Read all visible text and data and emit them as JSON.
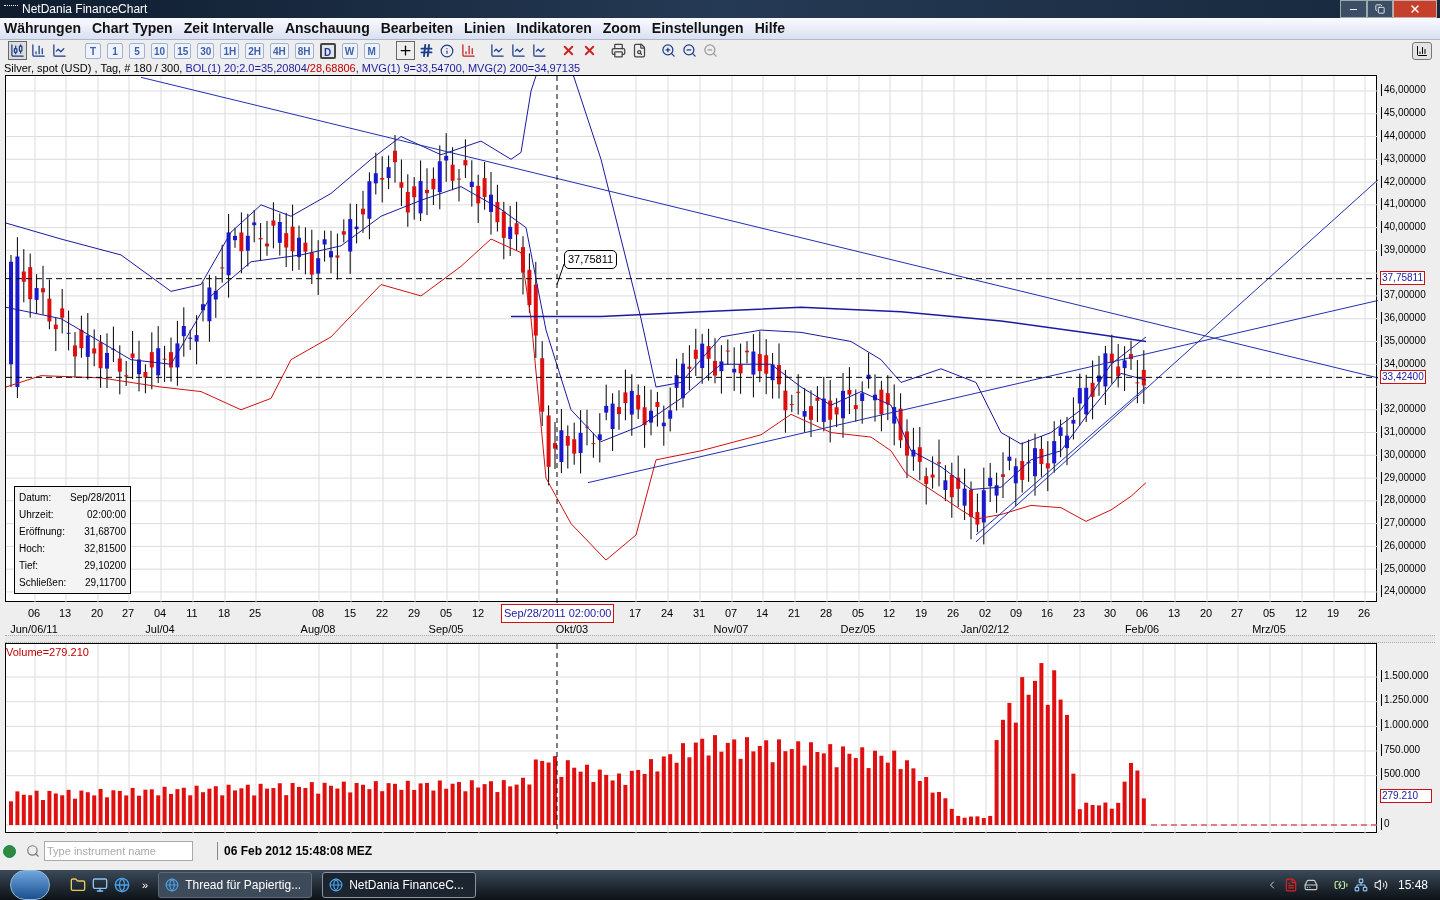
{
  "window": {
    "title": "NetDania FinanceChart"
  },
  "menu": [
    "Währungen",
    "Chart Typen",
    "Zeit Intervalle",
    "Anschauung",
    "Bearbeiten",
    "Linien",
    "Indikatoren",
    "Zoom",
    "Einstellungen",
    "Hilfe"
  ],
  "intervals": [
    {
      "label": "T",
      "selected": false
    },
    {
      "label": "1",
      "selected": false
    },
    {
      "label": "5",
      "selected": false
    },
    {
      "label": "10",
      "selected": false
    },
    {
      "label": "15",
      "selected": false
    },
    {
      "label": "30",
      "selected": false
    },
    {
      "label": "1H",
      "selected": false
    },
    {
      "label": "2H",
      "selected": false
    },
    {
      "label": "4H",
      "selected": false
    },
    {
      "label": "8H",
      "selected": false
    },
    {
      "label": "D",
      "selected": true
    },
    {
      "label": "W",
      "selected": false
    },
    {
      "label": "M",
      "selected": false
    }
  ],
  "info_line": [
    {
      "text": "Silver, spot (USD) , Tag, # 180 / 300, ",
      "color": "#000000"
    },
    {
      "text": "BOL(1) 20;2.0=35,20804",
      "color": "#1a1aa0"
    },
    {
      "text": "/28,68806",
      "color": "#c00000"
    },
    {
      "text": ", MVG(1) 9=33,54700, MVG(2) 200=34,97135",
      "color": "#1a1aa0"
    }
  ],
  "price_axis": [
    "46,00000",
    "45,00000",
    "44,00000",
    "43,00000",
    "42,00000",
    "41,00000",
    "40,00000",
    "39,00000",
    "37,00000",
    "36,00000",
    "35,00000",
    "34,00000",
    "32,00000",
    "31,00000",
    "30,00000",
    "29,00000",
    "28,00000",
    "27,00000",
    "26,00000",
    "25,00000",
    "24,00000"
  ],
  "price_markers": [
    "37,75811",
    "33,42400"
  ],
  "callout": "37,75811",
  "info_box": [
    {
      "label": "Datum:",
      "value": "Sep/28/2011"
    },
    {
      "label": "Uhrzeit:",
      "value": "02:00:00"
    },
    {
      "label": "Eröffnung:",
      "value": "31,68700"
    },
    {
      "label": "Hoch:",
      "value": "32,81500"
    },
    {
      "label": "Tief:",
      "value": "29,10200"
    },
    {
      "label": "Schließen:",
      "value": "29,11700"
    }
  ],
  "day_ticks": [
    "06",
    "13",
    "20",
    "27",
    "04",
    "11",
    "18",
    "25",
    "08",
    "15",
    "22",
    "29",
    "05",
    "12",
    "17",
    "24",
    "31",
    "07",
    "14",
    "21",
    "28",
    "05",
    "12",
    "19",
    "26",
    "02",
    "09",
    "16",
    "23",
    "30",
    "06",
    "13",
    "20",
    "27",
    "05",
    "12",
    "19",
    "26"
  ],
  "month_labels": [
    "Jun/06/11",
    "Jul/04",
    "Aug/08",
    "Sep/05",
    "Okt/03",
    "Nov/07",
    "Dez/05",
    "Jan/02/12",
    "Feb/06",
    "Mrz/05"
  ],
  "crosshair_date": "Sep/28/2011 02:00:00",
  "volume": {
    "title": "Volume=279.210",
    "axis": [
      "1.500.000",
      "1.250.000",
      "1.000.000",
      "750.000",
      "500.000",
      "0"
    ],
    "marker": "279.210"
  },
  "status_bar": {
    "search_placeholder": "Type instrument name",
    "datetime": "06 Feb 2012 15:48:08 MEZ"
  },
  "taskbar": {
    "overflow": "»",
    "tasks": [
      {
        "label": "Thread für Papiertig...",
        "selected": false
      },
      {
        "label": "NetDania FinanceC...",
        "selected": true
      }
    ],
    "clock": "15:48"
  }
}
